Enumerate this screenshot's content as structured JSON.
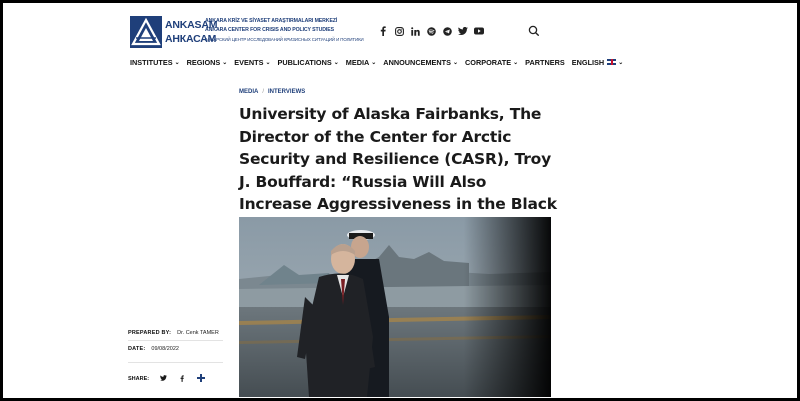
{
  "logo": {
    "word1": "ANKASAM",
    "word2": "АНКАСАМ",
    "line_tr": "ANKARA KRİZ VE SİYASET ARAŞTIRMALARI MERKEZİ",
    "line_en": "ANKARA CENTER FOR CRISIS AND POLICY STUDIES",
    "line_ru": "АНКАРСКИЙ ЦЕНТР ИССЛЕДОВАНИЙ КРИЗИСНЫХ СИТУАЦИЙ И ПОЛИТИКИ"
  },
  "social_icons": [
    "facebook-icon",
    "instagram-icon",
    "linkedin-icon",
    "spotify-icon",
    "telegram-icon",
    "twitter-icon",
    "youtube-icon"
  ],
  "nav": [
    {
      "label": "INSTITUTES",
      "dropdown": true
    },
    {
      "label": "REGIONS",
      "dropdown": true
    },
    {
      "label": "EVENTS",
      "dropdown": true
    },
    {
      "label": "PUBLICATIONS",
      "dropdown": true
    },
    {
      "label": "MEDIA",
      "dropdown": true
    },
    {
      "label": "ANNOUNCEMENTS",
      "dropdown": true
    },
    {
      "label": "CORPORATE",
      "dropdown": true
    },
    {
      "label": "PARTNERS",
      "dropdown": false
    },
    {
      "label": "ENGLISH",
      "dropdown": true
    }
  ],
  "breadcrumb": {
    "first": "MEDIA",
    "separator": "/",
    "second": "INTERVIEWS"
  },
  "article": {
    "title": "University of Alaska Fairbanks, The Director of the Center for Arctic Security and Resilience (CASR), Troy J. Bouffard: “Russia Will Also Increase Aggressiveness in the Black Sea.”"
  },
  "meta": {
    "prepared_by_label": "PREPARED BY:",
    "prepared_by_value": "Dr. Cenk TAMER",
    "date_label": "DATE:",
    "date_value": "09/08/2022",
    "share_label": "SHARE:"
  },
  "colors": {
    "brand": "#1f3f7a",
    "text": "#1a1a1a"
  }
}
